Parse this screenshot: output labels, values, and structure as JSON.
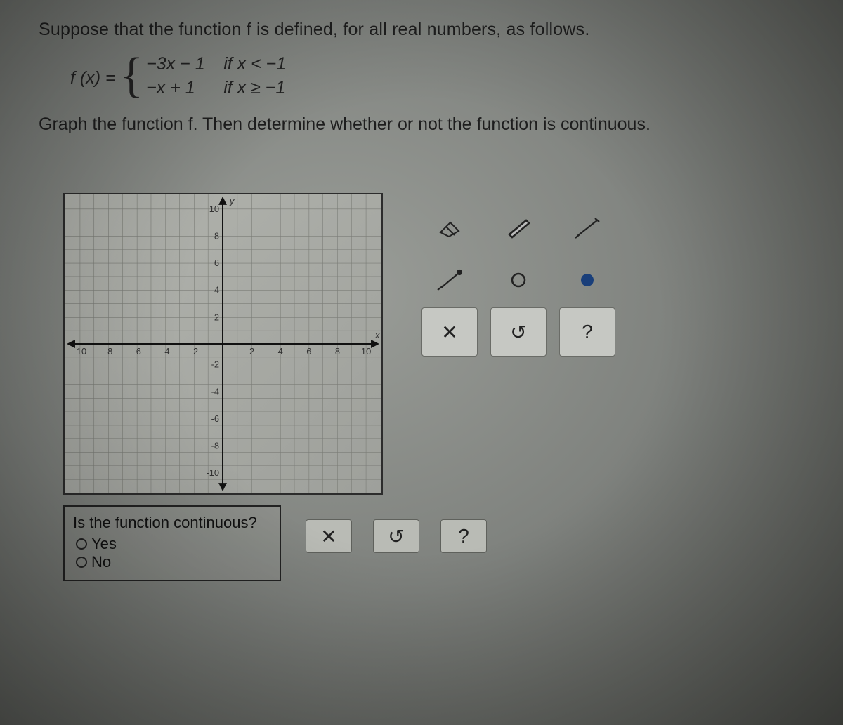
{
  "intro": "Suppose that the function f is defined, for all real numbers, as follows.",
  "piecewise": {
    "lhs": "f (x) =",
    "rows": [
      {
        "expr": "−3x − 1",
        "cond": "if x < −1"
      },
      {
        "expr": "−x + 1",
        "cond": "if x ≥ −1"
      }
    ]
  },
  "prompt2": "Graph the function f. Then determine whether or not the function is continuous.",
  "axes": {
    "x_ticks": [
      "-10",
      "-8",
      "-6",
      "-4",
      "-2",
      "2",
      "4",
      "6",
      "8",
      "10"
    ],
    "y_ticks_pos": [
      "2",
      "4",
      "6",
      "8",
      "10"
    ],
    "y_ticks_neg": [
      "-2",
      "-4",
      "-6",
      "-8",
      "-10"
    ],
    "x_axis_label": "x",
    "y_axis_label": "y"
  },
  "tools": {
    "t1": "⌫",
    "t2": "✎",
    "t3": "⟍",
    "t4": "⟋",
    "t5": "○",
    "t6": "●",
    "t7": "✕",
    "t8": "↺",
    "t9": "?"
  },
  "question": {
    "title": "Is the function continuous?",
    "opt_yes": "Yes",
    "opt_no": "No"
  },
  "checkbar": {
    "b1": "✕",
    "b2": "↺",
    "b3": "?"
  },
  "chart_data": {
    "type": "line",
    "title": "",
    "xlabel": "x",
    "ylabel": "y",
    "xlim": [
      -11,
      11
    ],
    "ylim": [
      -11,
      11
    ],
    "x_ticks": [
      -10,
      -8,
      -6,
      -4,
      -2,
      0,
      2,
      4,
      6,
      8,
      10
    ],
    "y_ticks": [
      -10,
      -8,
      -6,
      -4,
      -2,
      0,
      2,
      4,
      6,
      8,
      10
    ],
    "series": []
  }
}
